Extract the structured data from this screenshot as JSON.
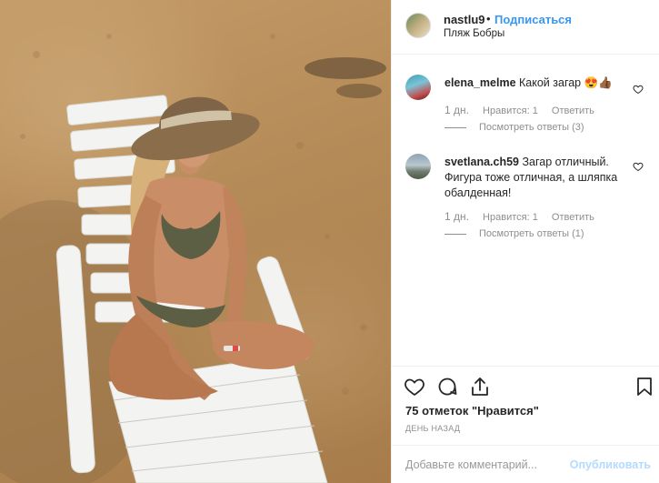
{
  "post": {
    "username": "nastlu9",
    "separator": "•",
    "follow_label": "Подписаться",
    "location": "Пляж Бобры"
  },
  "comments": [
    {
      "username": "elena_melme",
      "text": "Какой загар 😍👍🏾",
      "time": "1 дн.",
      "likes": "Нравится: 1",
      "reply_label": "Ответить",
      "view_replies": "Посмотреть ответы (3)"
    },
    {
      "username": "svetlana.ch59",
      "text": "Загар отличный. Фигура тоже отличная, а шляпка обалденная!",
      "time": "1 дн.",
      "likes": "Нравится: 1",
      "reply_label": "Ответить",
      "view_replies": "Посмотреть ответы (1)"
    }
  ],
  "actions": {
    "icons": [
      "heart-icon",
      "comment-icon",
      "share-icon",
      "bookmark-icon"
    ]
  },
  "likes_text": "75 отметок \"Нравится\"",
  "time_ago": "ДЕНЬ НАЗАД",
  "comment_input": {
    "placeholder": "Добавьте комментарий...",
    "post_label": "Опубликовать"
  },
  "colors": {
    "link_blue": "#3897f0",
    "post_disabled": "#b3dbff",
    "secondary_text": "#8e8e8e",
    "border": "#efefef"
  }
}
